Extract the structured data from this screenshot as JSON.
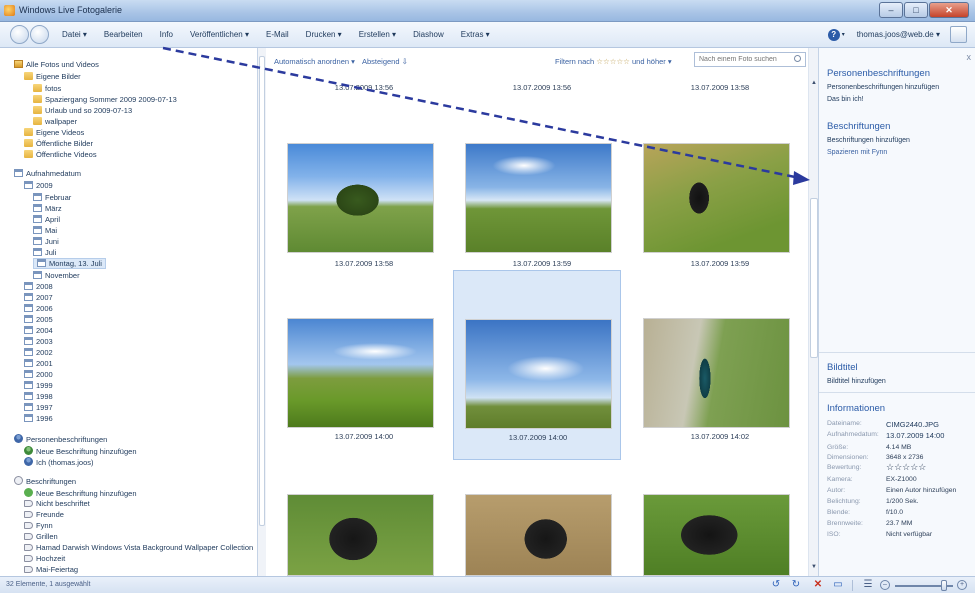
{
  "window": {
    "title": "Windows Live Fotogalerie",
    "min_symbol": "–",
    "max_symbol": "□",
    "close_symbol": "✕"
  },
  "menu": {
    "items": [
      "Datei ▾",
      "Bearbeiten",
      "Info",
      "Veröffentlichen ▾",
      "E-Mail",
      "Drucken ▾",
      "Erstellen ▾",
      "Diashow",
      "Extras ▾"
    ],
    "help_symbol": "?",
    "help_arrow": "▾",
    "account": "thomas.joos@web.de ▾"
  },
  "nav": {
    "all_photos": "Alle Fotos und Videos",
    "eigene_bilder": "Eigene Bilder",
    "folders": [
      "fotos",
      "Spaziergang Sommer 2009 2009-07-13",
      "Urlaub und so 2009-07-13",
      "wallpaper"
    ],
    "eigene_videos": "Eigene Videos",
    "oeffentliche_bilder": "Öffentliche Bilder",
    "oeffentliche_videos": "Öffentliche Videos",
    "aufnahmedatum": "Aufnahmedatum",
    "year_2009": "2009",
    "months": [
      "Februar",
      "März",
      "April",
      "Mai",
      "Juni",
      "Juli"
    ],
    "selected_day": "Montag, 13. Juli",
    "november": "November",
    "years": [
      "2008",
      "2007",
      "2006",
      "2005",
      "2004",
      "2003",
      "2002",
      "2001",
      "2000",
      "1999",
      "1998",
      "1997",
      "1996"
    ],
    "people_header": "Personenbeschriftungen",
    "people_items": [
      "Neue Beschriftung hinzufügen",
      "Ich (thomas.joos)"
    ],
    "tags_header": "Beschriftungen",
    "tag_add": "Neue Beschriftung hinzufügen",
    "tags": [
      "Nicht beschriftet",
      "Freunde",
      "Fynn",
      "Grillen",
      "Hamad Darwish Windows Vista Background Wallpaper Collection",
      "Hochzeit",
      "Mai-Feiertag"
    ]
  },
  "main": {
    "sort": "Automatisch anordnen ▾",
    "order": "Absteigend ⇩",
    "filter_label": "Filtern nach",
    "filter_stars": "☆☆☆☆☆",
    "filter_suffix": "und höher ▾",
    "search_placeholder": "Nach einem Foto suchen",
    "top_captions": [
      "13.07.2009 13:56",
      "13.07.2009 13:56",
      "13.07.2009 13:58"
    ],
    "thumbs": [
      {
        "caption": "13.07.2009 13:58",
        "style": "p-tree",
        "selected": false
      },
      {
        "caption": "13.07.2009 13:59",
        "style": "p-field",
        "selected": false
      },
      {
        "caption": "13.07.2009 13:59",
        "style": "p-dog-grass",
        "selected": false
      },
      {
        "caption": "13.07.2009 14:00",
        "style": "p-corn",
        "selected": false
      },
      {
        "caption": "13.07.2009 14:00",
        "style": "p-cloud",
        "selected": true
      },
      {
        "caption": "13.07.2009 14:02",
        "style": "p-person",
        "selected": false
      },
      {
        "caption": "",
        "style": "p-dog1",
        "selected": false
      },
      {
        "caption": "",
        "style": "p-dog2",
        "selected": false
      },
      {
        "caption": "",
        "style": "p-dog3",
        "selected": false
      }
    ]
  },
  "info_panel": {
    "close": "x",
    "people_title": "Personenbeschriftungen",
    "people_add": "Personenbeschriftungen hinzufügen",
    "people_value": "Das bin ich!",
    "tags_title": "Beschriftungen",
    "tags_add": "Beschriftungen hinzufügen",
    "tags_value": "Spazieren mit Fynn",
    "caption_title": "Bildtitel",
    "caption_add": "Bildtitel hinzufügen",
    "info_title": "Informationen",
    "rows": [
      {
        "k": "Dateiname:",
        "v": "CIMG2440.JPG"
      },
      {
        "k": "Aufnahmedatum:",
        "v": "13.07.2009  14:00"
      },
      {
        "k": "Größe:",
        "v": "4.14 MB"
      },
      {
        "k": "Dimensionen:",
        "v": "3648 x 2736"
      },
      {
        "k": "Bewertung:",
        "v": "☆☆☆☆☆"
      },
      {
        "k": "Kamera:",
        "v": "EX-Z1000"
      },
      {
        "k": "Autor:",
        "v": "Einen Autor hinzufügen"
      },
      {
        "k": "Belichtung:",
        "v": "1/200 Sek."
      },
      {
        "k": "Blende:",
        "v": "f/10.0"
      },
      {
        "k": "Brennweite:",
        "v": "23.7 MM"
      },
      {
        "k": "ISO:",
        "v": "Nicht verfügbar"
      }
    ]
  },
  "status": {
    "text": "32 Elemente, 1 ausgewählt",
    "rotate_left": "↺",
    "rotate_right": "↻",
    "delete": "✕",
    "slideshow": "▭",
    "details": "☰",
    "zoom_minus": "–",
    "zoom_plus": "+",
    "zoom_level": 0.85
  },
  "colors": {
    "accent": "#2c5ca8",
    "arrow": "#2b3a9e",
    "delete": "#c8301e",
    "rotate": "#2a5fb8"
  }
}
